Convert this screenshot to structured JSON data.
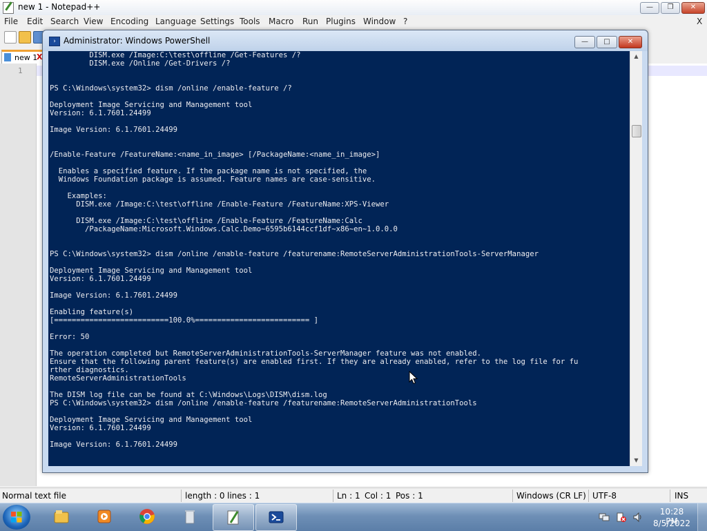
{
  "npp": {
    "title": "new 1 - Notepad++",
    "menu": [
      "File",
      "Edit",
      "Search",
      "View",
      "Encoding",
      "Language",
      "Settings",
      "Tools",
      "Macro",
      "Run",
      "Plugins",
      "Window",
      "?"
    ],
    "menu_close": "X",
    "tab_label": "new 1",
    "tab_close": "X",
    "line_number": "1",
    "status": {
      "type": "Normal text file",
      "length": "length : 0",
      "lines": "lines : 1",
      "ln": "Ln : 1",
      "col": "Col : 1",
      "pos": "Pos : 1",
      "eol": "Windows (CR LF)",
      "encoding": "UTF-8",
      "mode": "INS"
    }
  },
  "ps": {
    "title": "Administrator: Windows PowerShell",
    "console_lines": [
      "         DISM.exe /Image:C:\\test\\offline /Get-Features /?",
      "         DISM.exe /Online /Get-Drivers /?",
      "",
      "",
      "PS C:\\Windows\\system32> dism /online /enable-feature /?",
      "",
      "Deployment Image Servicing and Management tool",
      "Version: 6.1.7601.24499",
      "",
      "Image Version: 6.1.7601.24499",
      "",
      "",
      "/Enable-Feature /FeatureName:<name_in_image> [/PackageName:<name_in_image>]",
      "",
      "  Enables a specified feature. If the package name is not specified, the",
      "  Windows Foundation package is assumed. Feature names are case-sensitive.",
      "",
      "    Examples:",
      "      DISM.exe /Image:C:\\test\\offline /Enable-Feature /FeatureName:XPS-Viewer",
      "",
      "      DISM.exe /Image:C:\\test\\offline /Enable-Feature /FeatureName:Calc",
      "        /PackageName:Microsoft.Windows.Calc.Demo~6595b6144ccf1df~x86~en~1.0.0.0",
      "",
      "",
      "PS C:\\Windows\\system32> dism /online /enable-feature /featurename:RemoteServerAdministrationTools-ServerManager",
      "",
      "Deployment Image Servicing and Management tool",
      "Version: 6.1.7601.24499",
      "",
      "Image Version: 6.1.7601.24499",
      "",
      "Enabling feature(s)",
      "[==========================100.0%========================== ]",
      "",
      "Error: 50",
      "",
      "The operation completed but RemoteServerAdministrationTools-ServerManager feature was not enabled.",
      "Ensure that the following parent feature(s) are enabled first. If they are already enabled, refer to the log file for fu",
      "rther diagnostics.",
      "RemoteServerAdministrationTools",
      "",
      "The DISM log file can be found at C:\\Windows\\Logs\\DISM\\dism.log",
      "PS C:\\Windows\\system32> dism /online /enable-feature /featurename:RemoteServerAdministrationTools",
      "",
      "Deployment Image Servicing and Management tool",
      "Version: 6.1.7601.24499",
      "",
      "Image Version: 6.1.7601.24499"
    ],
    "colors": {
      "background": "#012456",
      "text": "#eeedf0"
    }
  },
  "taskbar": {
    "items": [
      "explorer-icon",
      "media-player-icon",
      "chrome-icon",
      "recycle-bin-icon",
      "notepad-plus-plus-icon",
      "powershell-icon"
    ],
    "time": "10:28 PM",
    "date": "8/5/2022"
  }
}
